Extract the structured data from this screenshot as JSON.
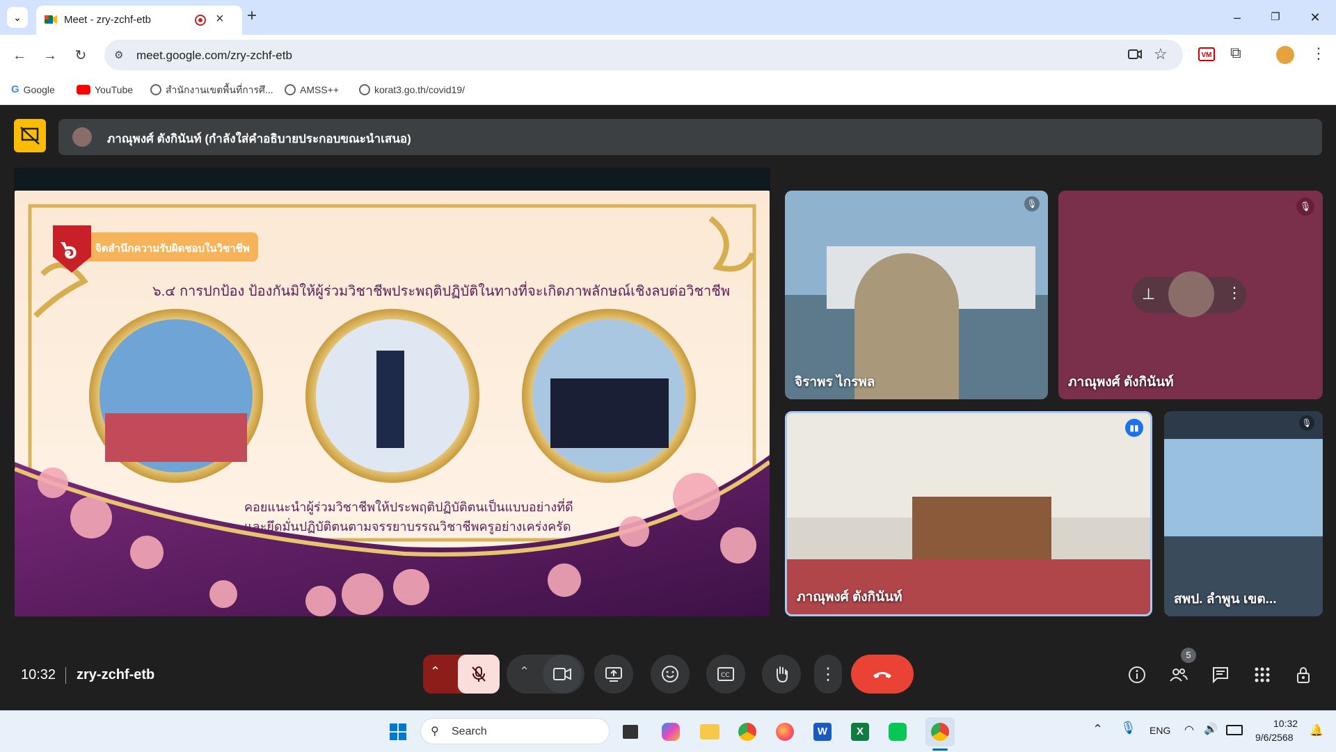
{
  "browser": {
    "tab_title": "Meet - zry-zchf-etb",
    "url": "meet.google.com/zry-zchf-etb",
    "new_tab_label": "+",
    "bookmarks": [
      {
        "label": "Google",
        "color": "#4285f4"
      },
      {
        "label": "YouTube",
        "color": "#ff0000"
      },
      {
        "label": "สำนักงานเขตพื้นที่การศึ...",
        "color": "#5f6368"
      },
      {
        "label": "AMSS++",
        "color": "#5f6368"
      },
      {
        "label": "korat3.go.th/covid19/",
        "color": "#5f6368"
      }
    ]
  },
  "meet": {
    "presenting_banner": "ภาณุพงศ์ ตังกินันท์ (กำลังใส่คำอธิบายประกอบขณะนำเสนอ)",
    "slide": {
      "badge_number": "๖",
      "badge_text": "จิตสำนึกความรับผิดชอบในวิชาชีพ",
      "heading": "๖.๔ การปกป้อง ป้องกันมิให้ผู้ร่วมวิชาชีพประพฤติปฏิบัติในทางที่จะเกิดภาพลักษณ์เชิงลบต่อวิชาชีพ",
      "caption_line1": "คอยแนะนำผู้ร่วมวิชาชีพให้ประพฤติปฏิบัติตนเป็นแบบอย่างที่ดี",
      "caption_line2": "และยึดมั่นปฏิบัติตนตามจรรยาบรรณวิชาชีพครูอย่างเคร่งครัด"
    },
    "participants": [
      {
        "name": "จิราพร ไกรพล",
        "muted": true
      },
      {
        "name": "ภาณุพงศ์ ตังกินันท์",
        "muted": true
      },
      {
        "name": "ภาณุพงศ์ ตังกินันท์",
        "speaking": true
      },
      {
        "name": "สพป. ลำพูน เขต...",
        "muted": true
      }
    ],
    "time": "10:32",
    "meeting_code": "zry-zchf-etb",
    "people_count": "5",
    "colors": {
      "end_call": "#ea4335",
      "mic_off": "#f9dedc",
      "banner_chip": "#fbbc04"
    }
  },
  "taskbar": {
    "search_placeholder": "Search",
    "language": "ENG",
    "clock_time": "10:32",
    "clock_date": "9/6/2568"
  }
}
